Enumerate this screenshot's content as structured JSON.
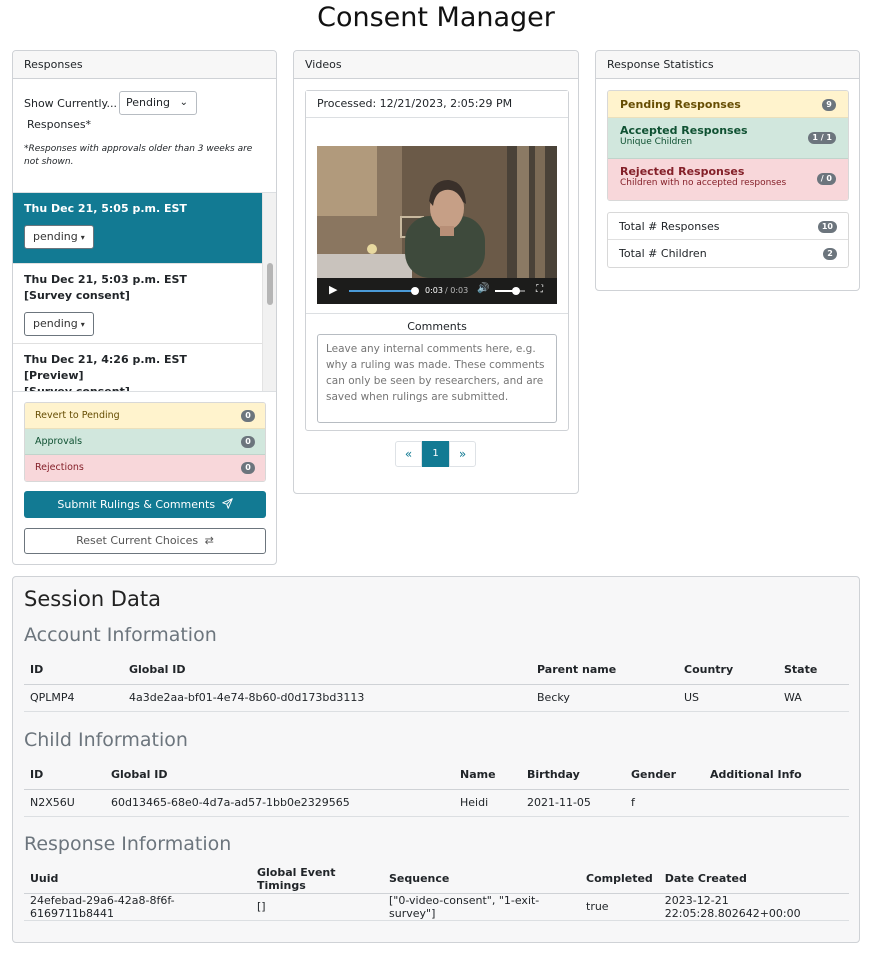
{
  "page": {
    "title": "Consent Manager"
  },
  "responses": {
    "header": "Responses",
    "show_label": "Show Currently...",
    "show_value": "Pending",
    "responses_word": "Responses*",
    "note": "*Responses with approvals older than 3 weeks are not shown.",
    "items": [
      {
        "time": "Thu Dec 21, 5:05 p.m. EST",
        "tags": [],
        "status": "pending",
        "active": true
      },
      {
        "time": "Thu Dec 21, 5:03 p.m. EST",
        "tags": [
          "[Survey consent]"
        ],
        "status": "pending",
        "active": false
      },
      {
        "time": "Thu Dec 21, 4:26 p.m. EST",
        "tags": [
          "[Preview]",
          "[Survey consent]"
        ],
        "status": "",
        "active": false
      }
    ],
    "counts": [
      {
        "label": "Revert to Pending",
        "value": "0"
      },
      {
        "label": "Approvals",
        "value": "0"
      },
      {
        "label": "Rejections",
        "value": "0"
      }
    ],
    "submit_label": "Submit Rulings & Comments",
    "reset_label": "Reset Current Choices"
  },
  "videos": {
    "header": "Videos",
    "processed": "Processed: 12/21/2023, 2:05:29 PM",
    "time_current": "0:03",
    "time_total": "/ 0:03",
    "progress": 1.0,
    "volume": 0.7,
    "comments_label": "Comments",
    "comments_placeholder": "Leave any internal comments here, e.g. why a ruling was made. These comments can only be seen by researchers, and are saved when rulings are submitted.",
    "pager": {
      "prev": "«",
      "current": "1",
      "next": "»"
    }
  },
  "stats": {
    "header": "Response Statistics",
    "pending": {
      "title": "Pending Responses",
      "badge": "9"
    },
    "accepted": {
      "title": "Accepted Responses",
      "sub": "Unique Children",
      "badge": "1 / 1"
    },
    "rejected": {
      "title": "Rejected Responses",
      "sub": "Children with no accepted responses",
      "badge": "/ 0"
    },
    "totals": [
      {
        "label": "Total # Responses",
        "value": "10"
      },
      {
        "label": "Total # Children",
        "value": "2"
      }
    ]
  },
  "session": {
    "title": "Session Data",
    "account": {
      "title": "Account Information",
      "headers": [
        "ID",
        "Global ID",
        "Parent name",
        "Country",
        "State"
      ],
      "row": [
        "QPLMP4",
        "4a3de2aa-bf01-4e74-8b60-d0d173bd3113",
        "Becky",
        "US",
        "WA"
      ]
    },
    "child": {
      "title": "Child Information",
      "headers": [
        "ID",
        "Global ID",
        "Name",
        "Birthday",
        "Gender",
        "Additional Info"
      ],
      "row": [
        "N2X56U",
        "60d13465-68e0-4d7a-ad57-1bb0e2329565",
        "Heidi",
        "2021-11-05",
        "f",
        ""
      ]
    },
    "response": {
      "title": "Response Information",
      "headers": [
        "Uuid",
        "Global Event Timings",
        "Sequence",
        "Completed",
        "Date Created"
      ],
      "row": [
        "24efebad-29a6-42a8-8f6f-6169711b8441",
        "[]",
        "[\"0-video-consent\", \"1-exit-survey\"]",
        "true",
        "2023-12-21 22:05:28.802642+00:00"
      ]
    }
  },
  "colors": {
    "primary": "#127a93",
    "warning_bg": "#fff3cd",
    "success_bg": "#d1e7dd",
    "danger_bg": "#f8d7da"
  }
}
